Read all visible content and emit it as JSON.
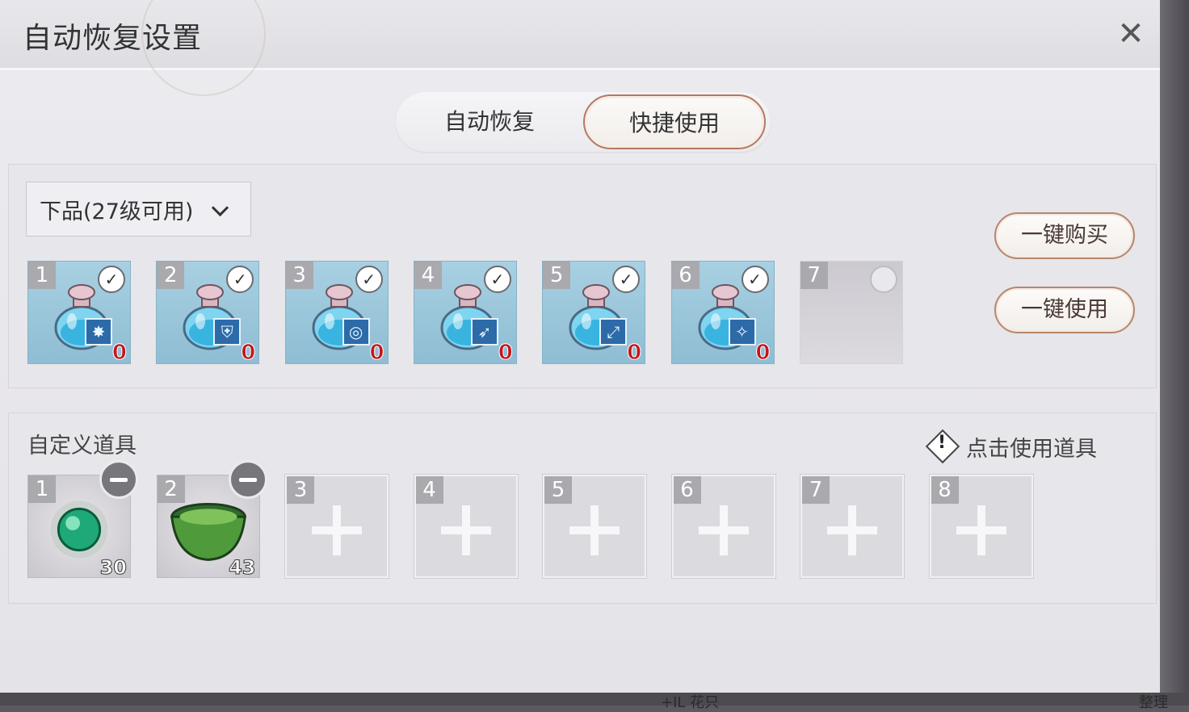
{
  "dialog": {
    "title": "自动恢复设置",
    "close_icon": "close-icon"
  },
  "tabs": [
    {
      "label": "自动恢复",
      "active": false
    },
    {
      "label": "快捷使用",
      "active": true
    }
  ],
  "quick_use": {
    "grade_select": {
      "selected": "下品(27级可用)"
    },
    "buy_all_label": "一键购买",
    "use_all_label": "一键使用",
    "slots": [
      {
        "index": "1",
        "item": "potion",
        "badge_icon": "burst-icon",
        "qty": "0",
        "checked": true
      },
      {
        "index": "2",
        "item": "potion",
        "badge_icon": "shield-icon",
        "qty": "0",
        "checked": true
      },
      {
        "index": "3",
        "item": "potion",
        "badge_icon": "target-icon",
        "qty": "0",
        "checked": true
      },
      {
        "index": "4",
        "item": "potion",
        "badge_icon": "run-icon",
        "qty": "0",
        "checked": true
      },
      {
        "index": "5",
        "item": "potion",
        "badge_icon": "bow-icon",
        "qty": "0",
        "checked": true
      },
      {
        "index": "6",
        "item": "potion",
        "badge_icon": "crest-icon",
        "qty": "0",
        "checked": true
      },
      {
        "index": "7",
        "item": "",
        "checked": false
      }
    ]
  },
  "custom_items": {
    "title": "自定义道具",
    "hint": "点击使用道具",
    "slots": [
      {
        "index": "1",
        "item": "green-orb",
        "count": "30"
      },
      {
        "index": "2",
        "item": "green-bowl",
        "count": "43"
      },
      {
        "index": "3",
        "item": "empty"
      },
      {
        "index": "4",
        "item": "empty"
      },
      {
        "index": "5",
        "item": "empty"
      },
      {
        "index": "6",
        "item": "empty"
      },
      {
        "index": "7",
        "item": "empty"
      },
      {
        "index": "8",
        "item": "empty"
      }
    ]
  },
  "colors": {
    "accent_border": "#b07a64",
    "qty_red": "#c4151c",
    "potion_slot": "#a8d0e2"
  },
  "background_peek": {
    "left_text": "+IL 花只",
    "right_text": "整理"
  }
}
